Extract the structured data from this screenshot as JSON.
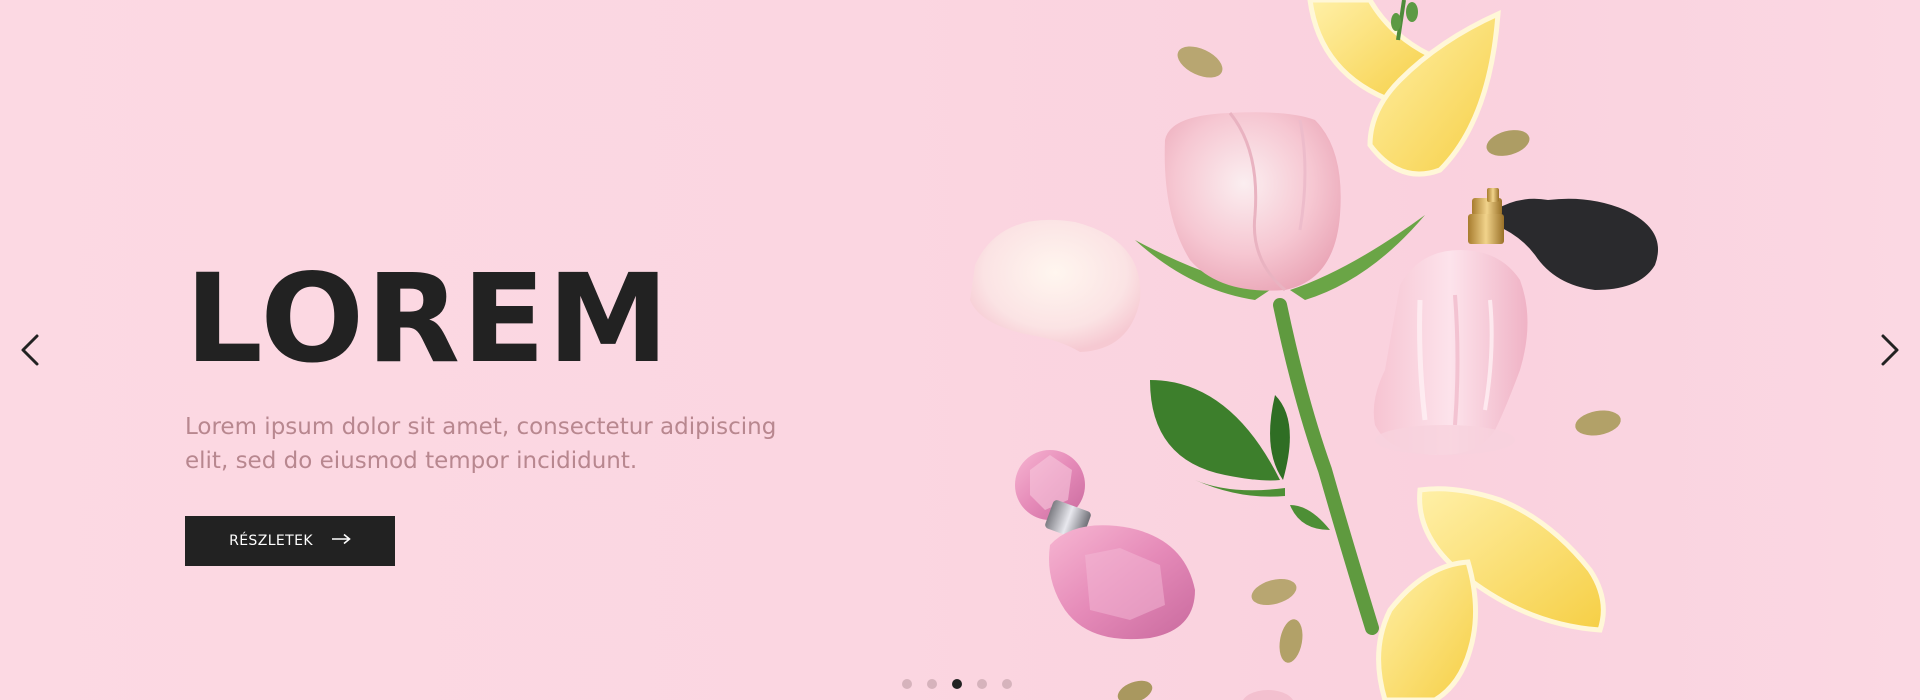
{
  "hero": {
    "title": "LOREM",
    "subtitle": "Lorem ipsum dolor sit amet, consectetur adipiscing elit, sed do eiusmod tempor incididunt.",
    "cta_label": "RÉSZLETEK",
    "cta_icon": "arrow-right-icon",
    "prev_icon": "chevron-left-icon",
    "next_icon": "chevron-right-icon",
    "image_description": "rose, perfume bottles, lemon slices and cardamom pods",
    "slide_count": 5,
    "active_slide": 3
  },
  "colors": {
    "background": "#fcd9e3",
    "title": "#222222",
    "subtitle": "#b8878f",
    "button": "#222222",
    "button_text": "#ffffff",
    "dot_inactive": "#d6b3bc",
    "dot_active": "#222222"
  }
}
